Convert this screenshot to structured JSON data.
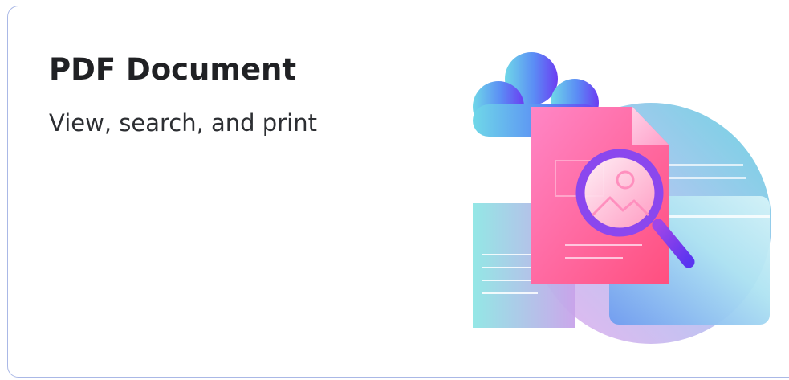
{
  "card": {
    "title": "PDF Document",
    "subtitle": "View, search, and print",
    "illustration_icon": "pdf-document-search-illustration"
  },
  "colors": {
    "card_border": "#aab8e6",
    "title_text": "#202124",
    "subtitle_text": "#2d2f33",
    "document_pink": "#ff5b95",
    "magnifier_purple": "#7b3cf0",
    "cloud_blue": "#5b8cf5",
    "teal": "#6fd8de"
  }
}
